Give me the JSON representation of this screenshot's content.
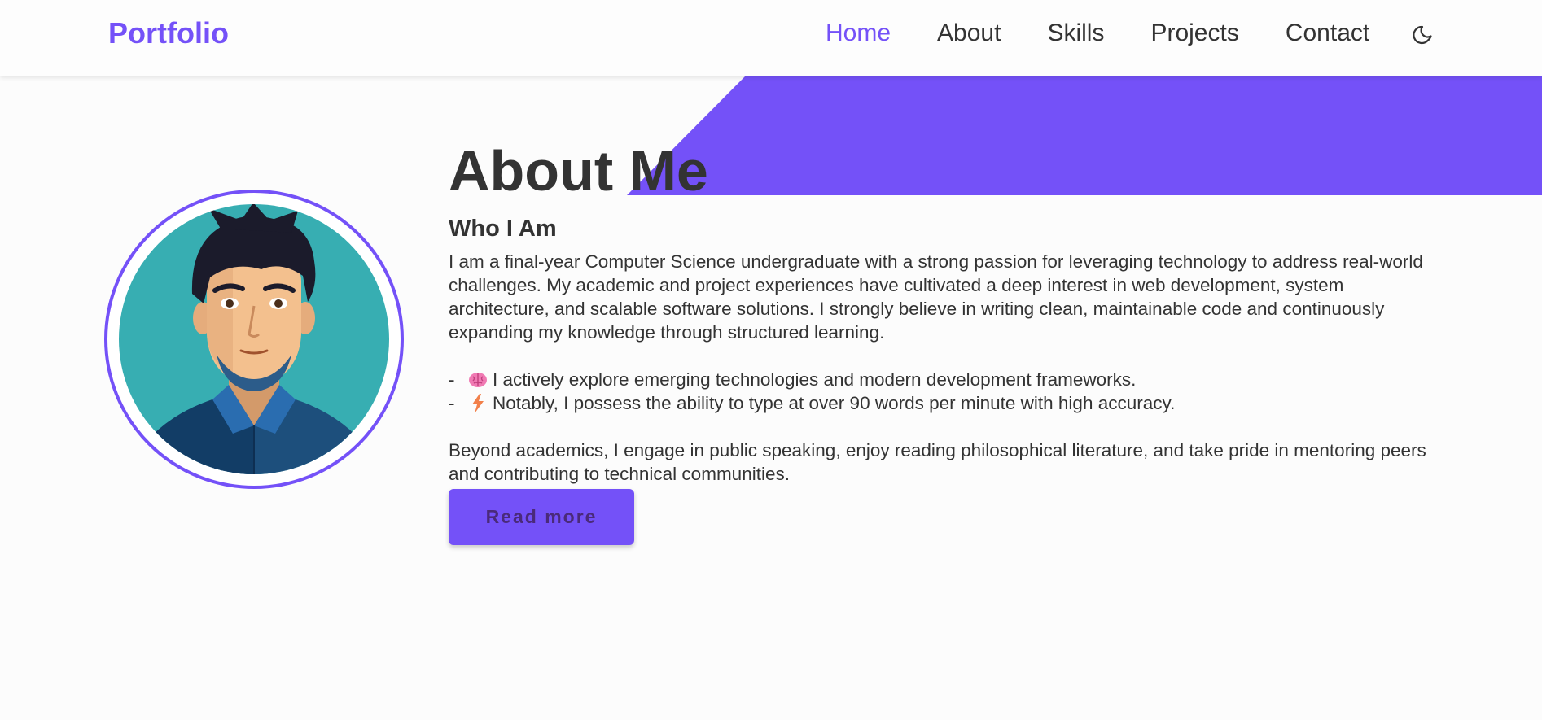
{
  "colors": {
    "accent": "#7451f8",
    "text": "#333333",
    "background": "#fcfcfc"
  },
  "nav": {
    "brand": "Portfolio",
    "links": [
      {
        "label": "Home",
        "active": true
      },
      {
        "label": "About",
        "active": false
      },
      {
        "label": "Skills",
        "active": false
      },
      {
        "label": "Projects",
        "active": false
      },
      {
        "label": "Contact",
        "active": false
      }
    ],
    "theme_icon": "moon-icon"
  },
  "about": {
    "title": "About Me",
    "subtitle": "Who I Am",
    "paragraph": "I am a final-year Computer Science undergraduate with a strong passion for leveraging technology to address real-world challenges. My academic and project experiences have cultivated a deep interest in web development, system architecture, and scalable software solutions. I strongly believe in writing clean, maintainable code and continuously expanding my knowledge through structured learning.",
    "bullets": [
      {
        "dash": "-",
        "icon": "brain-icon",
        "text": "I actively explore emerging technologies and modern development frameworks."
      },
      {
        "dash": "-",
        "icon": "lightning-icon",
        "text": "Notably, I possess the ability to type at over 90 words per minute with high accuracy."
      }
    ],
    "paragraph2": "Beyond academics, I engage in public speaking, enjoy reading philosophical literature, and take pride in mentoring peers and contributing to technical communities.",
    "button_label": "Read more"
  },
  "avatar": {
    "icon": "avatar-illustration"
  }
}
